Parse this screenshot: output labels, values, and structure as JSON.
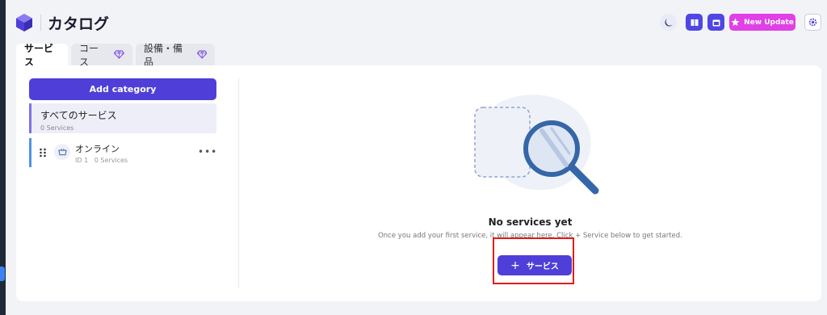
{
  "header": {
    "title": "カタログ",
    "new_update_label": "New Update"
  },
  "tabs": [
    {
      "label": "サービス",
      "active": true
    },
    {
      "label": "コース",
      "premium": true
    },
    {
      "label": "設備・備品",
      "premium": true
    }
  ],
  "sidebar": {
    "add_category_label": "Add category",
    "categories": [
      {
        "title": "すべてのサービス",
        "subtitle": "0 Services",
        "selected": true
      },
      {
        "title": "オンライン",
        "id_label": "ID 1",
        "subtitle": "0 Services"
      }
    ]
  },
  "empty_state": {
    "title": "No services yet",
    "description": "Once you add your first service, it will appear here. Click + Service below to get started.",
    "button_label": "サービス"
  },
  "colors": {
    "primary": "#4f3fd8",
    "update": "#e040e6",
    "highlight": "#e21b1b"
  }
}
